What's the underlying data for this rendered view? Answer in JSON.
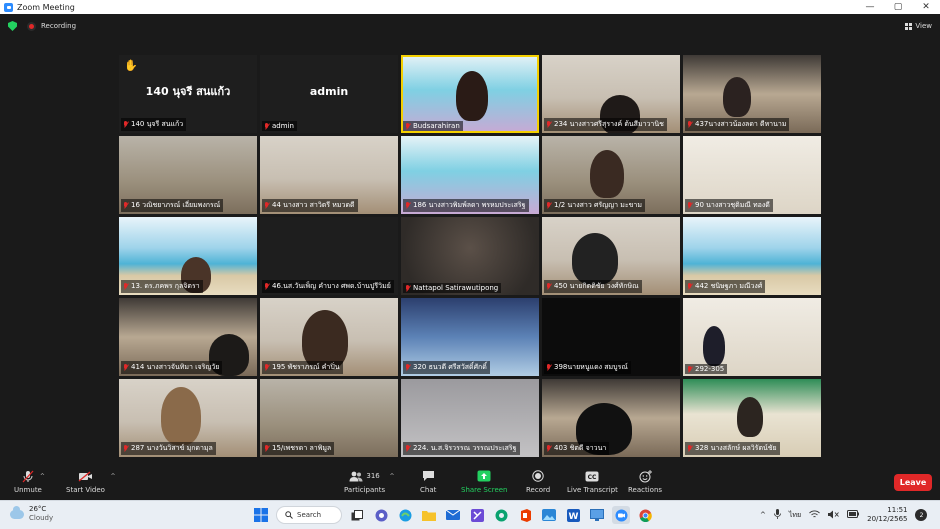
{
  "window": {
    "title": "Zoom Meeting"
  },
  "topbar": {
    "recording_label": "Recording",
    "view_label": "View"
  },
  "tiles": [
    {
      "name": "140 นุจรี สนแก้ว",
      "display": "140 นุจรี สนแก้ว",
      "bg": "bg-dark",
      "hand": true
    },
    {
      "name": "admin",
      "display": "admin",
      "bg": "bg-dark"
    },
    {
      "name": "Budsarahiran",
      "bg": "bg-slide",
      "active": true,
      "person": "#2a1b16"
    },
    {
      "name": "234 นางสาวศรีสุรางค์ ต้นสีมาวานิช",
      "bg": "bg-white-room",
      "person": "#1f1a18"
    },
    {
      "name": "437นางสาวน้องลดา ดีหานาม",
      "bg": "bg-kitchen",
      "person": "#2b2220"
    },
    {
      "name": "16 วณิชยาภรณ์ เอี่ยมพงกรณ์",
      "bg": "bg-room"
    },
    {
      "name": "44 นางสาว สาวิตรี หมวดดี",
      "bg": "bg-white-room"
    },
    {
      "name": "186 นางสาวพิมพ์ลดา พรหมประเสริฐ",
      "bg": "bg-slide"
    },
    {
      "name": "1/2 นางสาว ศรัญญา มะขาม",
      "bg": "bg-room",
      "person": "#3a2a22"
    },
    {
      "name": "90 นางสาวชุติมณี ทองดี",
      "bg": "bg-shelf"
    },
    {
      "name": "13. ดร.ภคพร กุลจิตรา",
      "bg": "bg-beach",
      "person": "#4a3428"
    },
    {
      "name": "46.นส.วันเพ็ญ คำบาง ศพด.บ้านปูรีวิมย์",
      "bg": "bg-dark"
    },
    {
      "name": "Nattapol Satirawutipong",
      "bg": "bg-blur"
    },
    {
      "name": "450 นายกิตติชัย วงศ์ทักษิณ",
      "bg": "bg-white-room",
      "person": "#222"
    },
    {
      "name": "442 ชนิษฐภา มณีวงศ์",
      "bg": "bg-beach"
    },
    {
      "name": "414 นางสาวจันทิมา เจริญวัย",
      "bg": "bg-kitchen",
      "person": "#1c1a18"
    },
    {
      "name": "195 พัชราภรณ์ คำปิ่น",
      "bg": "bg-white-room",
      "person": "#3b2a20"
    },
    {
      "name": "320 ธนวดี ศรีสวัสดิ์ศักดิ์",
      "bg": "bg-sky"
    },
    {
      "name": "398นายหนูแดง สมบูรณ์",
      "bg": "bg-black"
    },
    {
      "name": "292-305",
      "bg": "bg-shelf",
      "person": "#1e1e2a"
    },
    {
      "name": "287 นางวันวิสาข์ มุกดามุล",
      "bg": "bg-white-room",
      "person": "#8a6a4a"
    },
    {
      "name": "15/เพชรดา ลาพิมูล",
      "bg": "bg-room"
    },
    {
      "name": "224. น.ส.จิรวรรณ วรรณประเสริฐ",
      "bg": "bg-gray"
    },
    {
      "name": "403 ชิตดี จาวนา",
      "bg": "bg-kitchen",
      "person": "#111"
    },
    {
      "name": "328 นางสลักษ์ ผลวิรัตน์ชัย",
      "bg": "bg-garden",
      "person": "#2c2520"
    }
  ],
  "toolbar": {
    "unmute": "Unmute",
    "start_video": "Start Video",
    "participants": "Participants",
    "participants_count": "316",
    "chat": "Chat",
    "share_screen": "Share Screen",
    "record": "Record",
    "live_transcript": "Live Transcript",
    "reactions": "Reactions",
    "leave": "Leave"
  },
  "taskbar": {
    "temperature": "26°C",
    "weather": "Cloudy",
    "search": "Search",
    "language": "ไทย",
    "time": "11:51",
    "date": "20/12/2565",
    "notifications": "2"
  },
  "colors": {
    "accent": "#2d8cff",
    "leave": "#e02828",
    "share": "#23d160",
    "active_speaker": "#f5d000"
  }
}
